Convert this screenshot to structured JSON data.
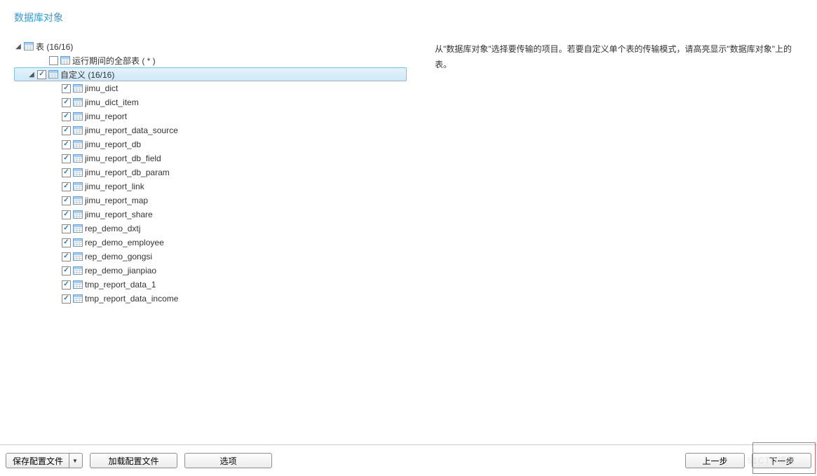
{
  "header": {
    "title": "数据库对象"
  },
  "tree": {
    "root": {
      "label": "表 (16/16)",
      "expanded": true
    },
    "runtime_all": {
      "label": "运行期间的全部表 ( * )",
      "checked": false
    },
    "custom": {
      "label": "自定义 (16/16)",
      "checked": true,
      "expanded": true,
      "selected": true
    },
    "items": [
      {
        "label": "jimu_dict",
        "checked": true
      },
      {
        "label": "jimu_dict_item",
        "checked": true
      },
      {
        "label": "jimu_report",
        "checked": true
      },
      {
        "label": "jimu_report_data_source",
        "checked": true
      },
      {
        "label": "jimu_report_db",
        "checked": true
      },
      {
        "label": "jimu_report_db_field",
        "checked": true
      },
      {
        "label": "jimu_report_db_param",
        "checked": true
      },
      {
        "label": "jimu_report_link",
        "checked": true
      },
      {
        "label": "jimu_report_map",
        "checked": true
      },
      {
        "label": "jimu_report_share",
        "checked": true
      },
      {
        "label": "rep_demo_dxtj",
        "checked": true
      },
      {
        "label": "rep_demo_employee",
        "checked": true
      },
      {
        "label": "rep_demo_gongsi",
        "checked": true
      },
      {
        "label": "rep_demo_jianpiao",
        "checked": true
      },
      {
        "label": "tmp_report_data_1",
        "checked": true
      },
      {
        "label": "tmp_report_data_income",
        "checked": true
      }
    ]
  },
  "description": "从\"数据库对象\"选择要传输的项目。若要自定义单个表的传输模式，请高亮显示\"数据库对象\"上的表。",
  "footer": {
    "save_profile": "保存配置文件",
    "load_profile": "加载配置文件",
    "options": "选项",
    "prev": "上一步",
    "next": "下一步"
  },
  "watermark": "51CTO博客"
}
